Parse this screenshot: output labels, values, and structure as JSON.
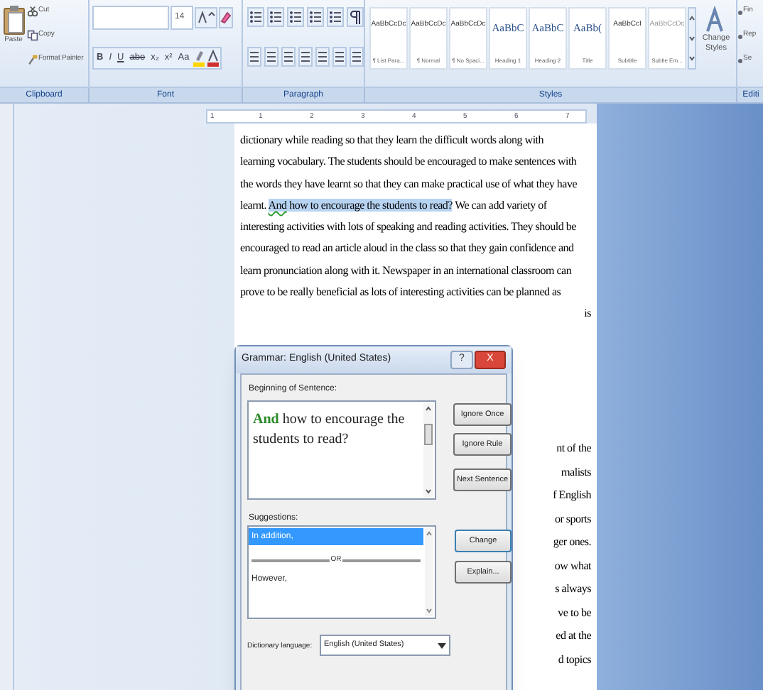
{
  "ribbon": {
    "clipboard": {
      "paste": "Paste",
      "cut": "Cut",
      "copy": "Copy",
      "format_painter": "Format Painter",
      "label": "Clipboard"
    },
    "font": {
      "size": "14",
      "format_buttons": [
        "B",
        "I",
        "U",
        "abe",
        "x₂",
        "x²",
        "Aa"
      ],
      "label": "Font"
    },
    "paragraph": {
      "label": "Paragraph"
    },
    "styles": {
      "items": [
        {
          "sample": "AaBbCcDc",
          "name": "¶ List Para...",
          "kind": "body"
        },
        {
          "sample": "AaBbCcDc",
          "name": "¶ Normal",
          "kind": "body"
        },
        {
          "sample": "AaBbCcDc",
          "name": "¶ No Spaci...",
          "kind": "body"
        },
        {
          "sample": "AaBbC",
          "name": "Heading 1",
          "kind": "heading"
        },
        {
          "sample": "AaBbC",
          "name": "Heading 2",
          "kind": "heading"
        },
        {
          "sample": "AaBb(",
          "name": "Title",
          "kind": "heading"
        },
        {
          "sample": "AaBbCcI",
          "name": "Subtitle",
          "kind": "body"
        },
        {
          "sample": "AaBbCcDc",
          "name": "Subtle Em...",
          "kind": "faint"
        }
      ],
      "change_styles": "Change Styles",
      "label": "Styles"
    },
    "editing": {
      "items": [
        "Fin",
        "Rep",
        "Se"
      ],
      "label": "Editi"
    }
  },
  "ruler": {
    "numbers": [
      "1",
      "1",
      "2",
      "3",
      "4",
      "5",
      "6",
      "7"
    ]
  },
  "document": {
    "lines": [
      {
        "kind": "plain",
        "text": "dictionary while reading so that they learn the difficult words along with"
      },
      {
        "kind": "plain",
        "text": "learning vocabulary. The students should be encouraged to make sentences with"
      },
      {
        "kind": "plain",
        "text": "the words they have learnt so that they can make practical use of what they have"
      },
      {
        "kind": "selection",
        "before": "learnt. ",
        "flagged": "And",
        "selected": " how to encourage the students to read?",
        "after": " We can add variety of"
      },
      {
        "kind": "plain",
        "text": "interesting activities with lots of speaking and reading activities. They should be"
      },
      {
        "kind": "plain",
        "text": "encouraged to read an article aloud in the class so that they gain confidence and"
      },
      {
        "kind": "plain",
        "text": "learn pronunciation along with it. Newspaper in an international classroom can"
      },
      {
        "kind": "plain",
        "text": "prove to be really beneficial as lots of interesting activities can be planned as"
      }
    ],
    "covered_line_end": "is",
    "fragments": [
      "nt of the",
      "rnalists",
      "f English",
      "or sports",
      "ger ones.",
      "ow what",
      "s always",
      "ve to be",
      "ed at the",
      "d topics"
    ]
  },
  "dialog": {
    "title": "Grammar: English (United States)",
    "help": "?",
    "close": "X",
    "sentence_label": "Beginning of Sentence:",
    "sentence": {
      "flagged": "And",
      "rest": " how to encourage the students to read?"
    },
    "buttons": [
      "Ignore Once",
      "Ignore Rule",
      "Next Sentence"
    ],
    "suggestions_label": "Suggestions:",
    "suggestions": [
      {
        "kind": "item",
        "text": "In addition,",
        "selected": true
      },
      {
        "kind": "separator",
        "text": "OR"
      },
      {
        "kind": "item",
        "text": "However,",
        "selected": false
      }
    ],
    "side_buttons": [
      "Change",
      "Explain..."
    ],
    "language_label": "Dictionary language:",
    "language": "English (United States)"
  }
}
